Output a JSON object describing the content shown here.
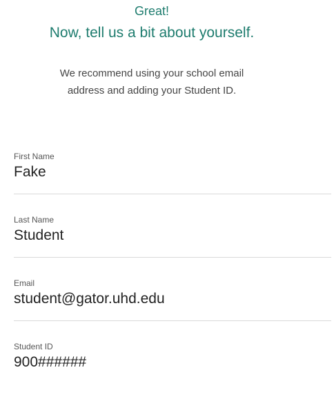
{
  "header": {
    "line1": "Great!",
    "line2": "Now, tell us a bit about yourself.",
    "sub_line1": "We recommend using your school email",
    "sub_line2": "address and adding your Student ID."
  },
  "form": {
    "first_name": {
      "label": "First Name",
      "value": "Fake"
    },
    "last_name": {
      "label": "Last Name",
      "value": "Student"
    },
    "email": {
      "label": "Email",
      "value": "student@gator.uhd.edu"
    },
    "student_id": {
      "label": "Student ID",
      "value": "900######"
    }
  },
  "colors": {
    "accent": "#1e7c6e",
    "divider": "#d9d9d9"
  }
}
